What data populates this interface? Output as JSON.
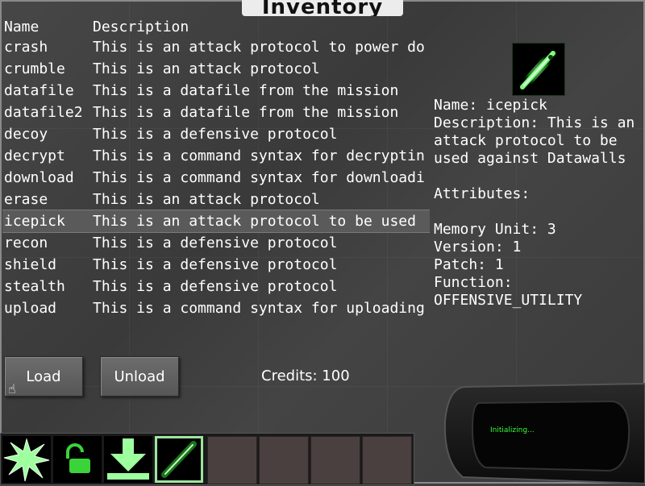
{
  "window": {
    "title": "Inventory"
  },
  "list": {
    "headers": {
      "name": "Name",
      "description": "Description"
    },
    "rows": [
      {
        "name": "crash",
        "description": "This is an attack protocol to power do"
      },
      {
        "name": "crumble",
        "description": "This is an attack protocol"
      },
      {
        "name": "datafile",
        "description": "This is a datafile from the mission"
      },
      {
        "name": "datafile2",
        "description": "This is a datafile from the mission"
      },
      {
        "name": "decoy",
        "description": "This is a defensive protocol"
      },
      {
        "name": "decrypt",
        "description": "This is a command syntax for decryptin"
      },
      {
        "name": "download",
        "description": "This is a command syntax for downloadi"
      },
      {
        "name": "erase",
        "description": "This is an attack protocol"
      },
      {
        "name": "icepick",
        "description": "This is an attack protocol to be used"
      },
      {
        "name": "recon",
        "description": "This is a defensive protocol"
      },
      {
        "name": "shield",
        "description": "This is a defensive protocol"
      },
      {
        "name": "stealth",
        "description": "This is a defensive protocol"
      },
      {
        "name": "upload",
        "description": "This is a command syntax for uploading"
      }
    ],
    "selected": "icepick"
  },
  "detail": {
    "icon": "icepick-icon",
    "name_line": "Name: icepick",
    "description_line": "Description: This is an attack protocol to be used against Datawalls",
    "attributes_label": "Attributes:",
    "memory_unit": "Memory Unit: 3",
    "version": "Version: 1",
    "patch": "Patch: 1",
    "function_label": "Function:",
    "function_value": "OFFENSIVE_UTILITY"
  },
  "buttons": {
    "load": "Load",
    "unload": "Unload"
  },
  "credits": "Credits: 100",
  "hotbar": {
    "slots": [
      "crash-icon",
      "unlock-icon",
      "download-icon",
      "icepick-icon",
      "empty",
      "empty",
      "empty",
      "empty"
    ],
    "selected_index": 3
  },
  "console": {
    "status": "Initializing..."
  },
  "colors": {
    "accent_green": "#37ff37",
    "selection": "#5a5a5a"
  }
}
